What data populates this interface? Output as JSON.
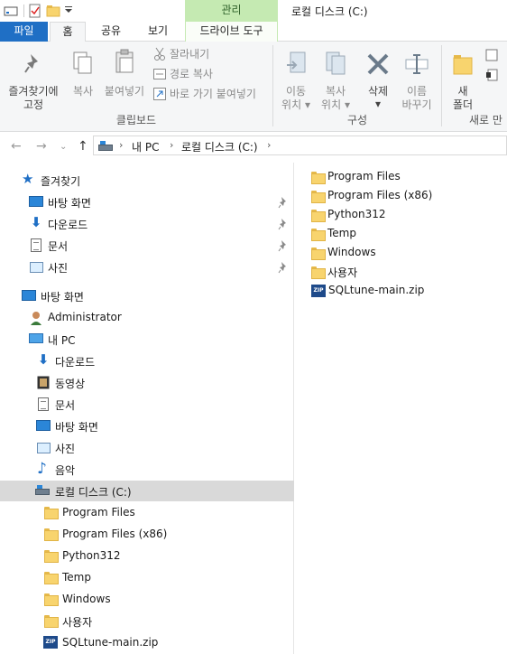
{
  "window": {
    "title": "로컬 디스크 (C:)",
    "context_header": "관리"
  },
  "tabs": {
    "file": "파일",
    "home": "홈",
    "share": "공유",
    "view": "보기",
    "drive_tools": "드라이브 도구"
  },
  "ribbon": {
    "pin": "즐겨찾기에\n고정",
    "pin_line1": "즐겨찾기에",
    "pin_line2": "고정",
    "copy": "복사",
    "paste": "붙여넣기",
    "cut": "잘라내기",
    "copy_path": "경로 복사",
    "paste_shortcut": "바로 가기 붙여넣기",
    "move_to_line1": "이동",
    "move_to_line2": "위치",
    "copy_to_line1": "복사",
    "copy_to_line2": "위치",
    "delete": "삭제",
    "rename_line1": "이름",
    "rename_line2": "바꾸기",
    "new_folder_line1": "새",
    "new_folder_line2": "폴더",
    "group_clipboard": "클립보드",
    "group_organize": "구성",
    "group_new": "새로 만"
  },
  "address": {
    "crumbs": [
      "내 PC",
      "로컬 디스크 (C:)"
    ]
  },
  "nav": {
    "quick_access": "즐겨찾기",
    "qa_items": [
      "바탕 화면",
      "다운로드",
      "문서",
      "사진"
    ],
    "desktop": "바탕 화면",
    "user": "Administrator",
    "this_pc": "내 PC",
    "pc_items": [
      "다운로드",
      "동영상",
      "문서",
      "바탕 화면",
      "사진",
      "음악"
    ],
    "drive": "로컬 디스크 (C:)",
    "drive_items": [
      "Program Files",
      "Program Files (x86)",
      "Python312",
      "Temp",
      "Windows",
      "사용자",
      "SQLtune-main.zip"
    ]
  },
  "content": {
    "items": [
      "Program Files",
      "Program Files (x86)",
      "Python312",
      "Temp",
      "Windows",
      "사용자",
      "SQLtune-main.zip"
    ]
  },
  "colors": {
    "accent": "#1f6fc5",
    "context": "#c5eab2",
    "selection": "#d9d9d9"
  }
}
